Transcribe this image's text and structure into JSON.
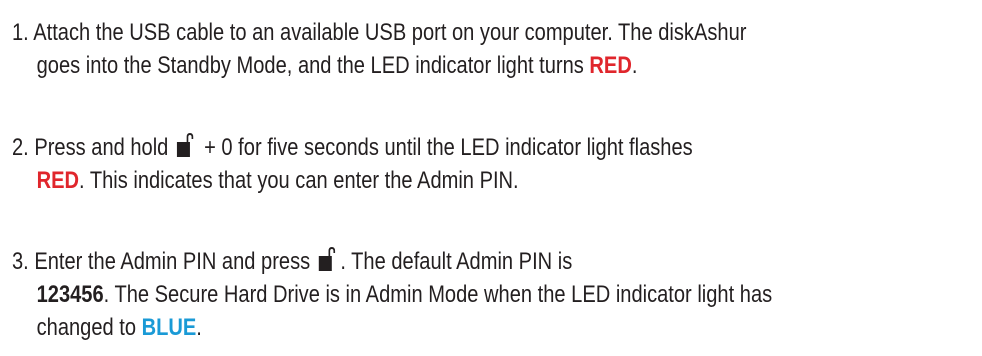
{
  "steps": [
    {
      "line1": "1. Attach the USB cable to an available USB port on your computer. The diskAshur",
      "line2_pre": "goes into the Standby Mode, and the LED indicator light turns ",
      "line2_red": "RED",
      "line2_post": "."
    },
    {
      "line1_pre": "2. Press and hold ",
      "lock_icon": "unlock-icon",
      "line1_post": " + 0 for five seconds until the LED indicator light flashes",
      "line2_red": "RED",
      "line2_post": ". This indicates that you can enter the Admin PIN."
    },
    {
      "line1_pre": "3. Enter the Admin PIN and press ",
      "lock_icon": "unlock-icon",
      "line1_post": ". The default Admin PIN is",
      "line2_bold": "123456",
      "line2_post": ". The Secure Hard Drive is in Admin Mode when the LED indicator light has",
      "line3_pre": "changed to ",
      "line3_blue": "BLUE",
      "line3_post": "."
    }
  ],
  "colors": {
    "text": "#231f20",
    "red": "#e0262c",
    "blue": "#1a9ad6"
  }
}
